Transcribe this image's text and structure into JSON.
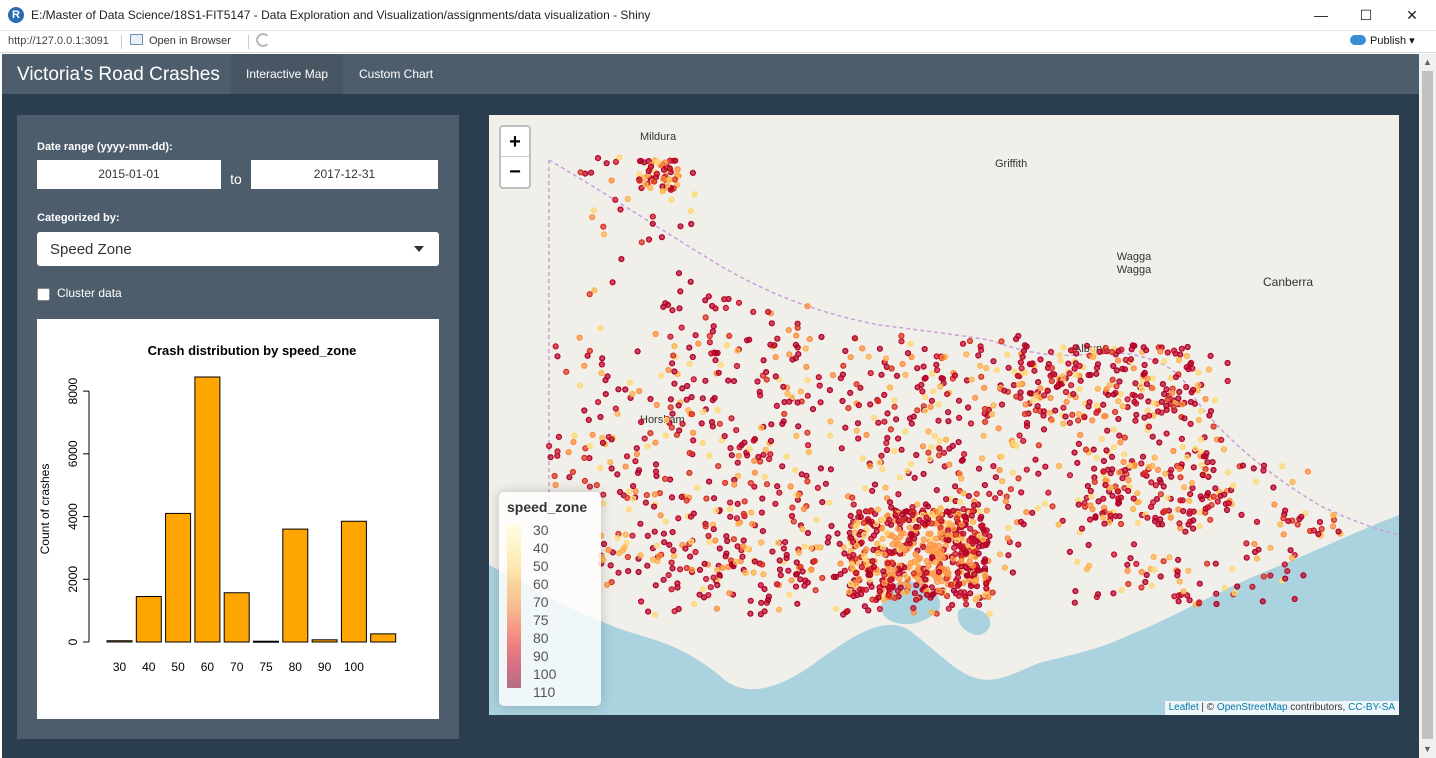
{
  "window": {
    "title": "E:/Master of Data Science/18S1-FIT5147 - Data Exploration and Visualization/assignments/data visualization - Shiny",
    "logo": "R",
    "minimize": "—",
    "maximize": "☐",
    "close": "✕"
  },
  "address": {
    "url": "http://127.0.0.1:3091",
    "open_browser": "Open in Browser",
    "publish": "Publish",
    "publish_caret": "▾"
  },
  "navbar": {
    "brand": "Victoria's Road Crashes",
    "tabs": [
      {
        "label": "Interactive Map",
        "active": true
      },
      {
        "label": "Custom Chart",
        "active": false
      }
    ]
  },
  "sidebar": {
    "date_range_label": "Date range (yyyy-mm-dd):",
    "date_start": "2015-01-01",
    "date_to": "to",
    "date_end": "2017-12-31",
    "categorized_label": "Categorized by:",
    "categorized_value": "Speed Zone",
    "cluster_label": "Cluster data",
    "cluster_checked": false
  },
  "chart_data": {
    "type": "bar",
    "title": "Crash distribution by speed_zone",
    "ylabel": "Count of crashes",
    "xlabel": "",
    "categories": [
      "30",
      "40",
      "50",
      "60",
      "70",
      "75",
      "80",
      "90",
      "100",
      "110"
    ],
    "x_tick_labels": [
      "30",
      "40",
      "50",
      "60",
      "70",
      "75",
      "80",
      "90",
      "100"
    ],
    "values": [
      40,
      1450,
      4100,
      8450,
      1570,
      25,
      3600,
      70,
      3850,
      260
    ],
    "ylim": [
      0,
      8450
    ],
    "yticks": [
      0,
      2000,
      4000,
      6000,
      8000
    ],
    "bar_color": "#ffa500",
    "grid": false
  },
  "map": {
    "zoom_in": "+",
    "zoom_out": "−",
    "cities": [
      "Mildura",
      "Griffith",
      "Wagga Wagga",
      "Canberra",
      "Albury",
      "Horsham"
    ],
    "legend": {
      "title": "speed_zone",
      "items": [
        "30",
        "40",
        "50",
        "60",
        "70",
        "75",
        "80",
        "90",
        "100",
        "110"
      ]
    },
    "attribution": {
      "leaflet": "Leaflet",
      "sep": " | © ",
      "osm": "OpenStreetMap",
      "contributors": " contributors, ",
      "license": "CC-BY-SA"
    },
    "colors": {
      "high_speed": "#b10026",
      "low_speed": "#ffeda0",
      "mid_speed": "#fd8d3c",
      "sea": "#aad3df",
      "land": "#f1efe9"
    }
  },
  "colors": {
    "navbar": "#4e5d6c",
    "app_bg": "#2b3e50",
    "sidebar": "#4e5d6c"
  }
}
